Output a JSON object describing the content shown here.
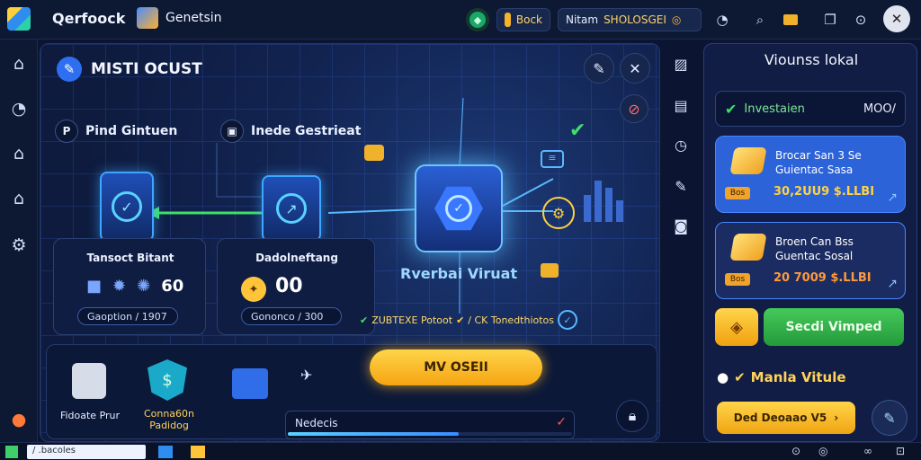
{
  "topbar": {
    "app_name": "Qerfoock",
    "tab_name": "Genetsin",
    "chip_buy": "Bock",
    "chip_meta_label": "Nitam",
    "chip_meta_value": "SHOLOSGEI",
    "icons": [
      "gem-icon",
      "coin-icon",
      "globe-icon",
      "search-icon",
      "folder-icon",
      "window-icon",
      "settings-icon",
      "avatar-icon"
    ]
  },
  "sidebar": {
    "icons": [
      "home-icon",
      "chart-icon",
      "house-icon",
      "home-alt-icon",
      "settings-icon",
      "alert-icon"
    ]
  },
  "main": {
    "title": "MISTI OCUST",
    "section_left": "Pind Gintuen",
    "section_right": "Inede Gestrieat",
    "card_left": {
      "title": "Tansoct Bitant",
      "pill": "Gaoption / 1907"
    },
    "card_mid": {
      "title": "Dadolneftang",
      "count": "00",
      "pill": "Gononco / 300"
    },
    "hub_caption": "Rverbai Viruat",
    "status_text": "ZUBTEXE Potoot",
    "status_tail": "/ CK Tonedthiotos",
    "bottom_items": [
      {
        "label": "Fidoate Prur"
      },
      {
        "label": "Conna60n Padidog"
      }
    ],
    "cta_label": "MV OSEII",
    "progress": {
      "label": "Nedecis",
      "fraction": 0.6
    }
  },
  "right_panel": {
    "title": "Viounss lokal",
    "row": {
      "label": "Investaien",
      "value": "MOO/"
    },
    "offers": [
      {
        "line1": "Brocar San 3 Se",
        "line2": "Guientac Sasa",
        "price": "30,2UU9 $.LLBI",
        "tag": "Bos",
        "color": "#2c63d8"
      },
      {
        "line1": "Broen Can Bss",
        "line2": "Guentac Sosal",
        "price": "20 7009 $.LLBI",
        "tag": "Bos",
        "color": "#1b2c62"
      }
    ],
    "green_button": "Secdi Vimped",
    "note": "Manla Vitule",
    "yellow_button": "Ded Deoaao V5"
  },
  "taskbar": {
    "search": "/ .bacoles"
  }
}
